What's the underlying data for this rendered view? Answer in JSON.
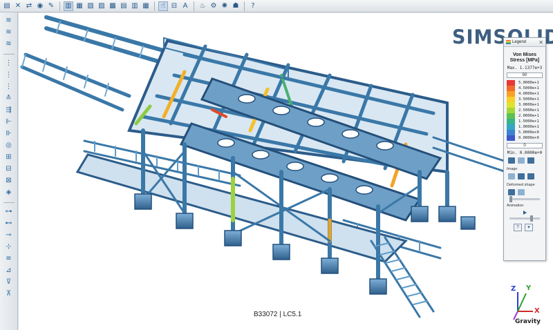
{
  "toolbar": {
    "buttons": [
      {
        "name": "open-icon",
        "glyph": "▤"
      },
      {
        "name": "cross-icon",
        "glyph": "✕"
      },
      {
        "name": "transform-icon",
        "glyph": "⇄"
      },
      {
        "name": "eye-icon",
        "glyph": "◉"
      },
      {
        "name": "pencil-icon",
        "glyph": "✎"
      },
      {
        "name": "sep"
      },
      {
        "name": "view-front-icon",
        "glyph": "▥",
        "active": true
      },
      {
        "name": "view-side-icon",
        "glyph": "▦"
      },
      {
        "name": "view-iso-icon",
        "glyph": "▧"
      },
      {
        "name": "view-top-icon",
        "glyph": "▨"
      },
      {
        "name": "view-bottom-icon",
        "glyph": "▩"
      },
      {
        "name": "view-left-icon",
        "glyph": "▤"
      },
      {
        "name": "view-right-icon",
        "glyph": "▥"
      },
      {
        "name": "view-back-icon",
        "glyph": "▦"
      },
      {
        "name": "sep"
      },
      {
        "name": "select-icon",
        "glyph": "☝",
        "active": true
      },
      {
        "name": "section-icon",
        "glyph": "⊟"
      },
      {
        "name": "measure-icon",
        "glyph": "A"
      },
      {
        "name": "sep"
      },
      {
        "name": "connections-icon",
        "glyph": "♨"
      },
      {
        "name": "bolt-icon",
        "glyph": "⚙"
      },
      {
        "name": "weld-icon",
        "glyph": "✺"
      },
      {
        "name": "material-icon",
        "glyph": "☗"
      },
      {
        "name": "sep"
      },
      {
        "name": "help-icon",
        "glyph": "?"
      }
    ]
  },
  "left_toolbar": {
    "groups": [
      [
        "≋",
        "≋",
        "≋"
      ],
      [
        "⋮",
        "⋮",
        "⋮",
        "≛",
        "⇶",
        "⊩",
        "⊪",
        "◎",
        "⊞",
        "⊟",
        "⊠",
        "◈"
      ],
      [
        "⊶",
        "⊷",
        "⊸",
        "⊹",
        "≡",
        "⊿",
        "⊽",
        "⊼"
      ]
    ]
  },
  "brand": {
    "text": "SIMSOLID",
    "color": "#3f5f80"
  },
  "caption": "B33072 | LC5.1",
  "legend": {
    "header": "Legend",
    "title_line1": "Von Mises",
    "title_line2": "Stress [MPa]",
    "max": "Max. 1.1377e+3",
    "upper_input": "50",
    "lower_input": "0",
    "min": "Min. 0.0000e+0",
    "scale": [
      {
        "label": "5.0000e+1",
        "color": "#e8363a"
      },
      {
        "label": "4.5000e+1",
        "color": "#f06a2a"
      },
      {
        "label": "4.0000e+1",
        "color": "#f7a126"
      },
      {
        "label": "3.5000e+1",
        "color": "#f6cf2c"
      },
      {
        "label": "3.0000e+1",
        "color": "#dfe32e"
      },
      {
        "label": "2.5000e+1",
        "color": "#a4d63a"
      },
      {
        "label": "2.0000e+1",
        "color": "#5cc24f"
      },
      {
        "label": "1.5000e+1",
        "color": "#38b488"
      },
      {
        "label": "1.0000e+1",
        "color": "#33a7c4"
      },
      {
        "label": "5.0000e+0",
        "color": "#3f82d0"
      },
      {
        "label": "0.0000e+0",
        "color": "#3c58c7"
      }
    ],
    "image_label": "Image",
    "deformed_label": "Deformed shape",
    "animation_label": "Animation"
  },
  "triad": {
    "z": "Z",
    "y": "Y",
    "x": "X",
    "gravity": "Gravity"
  }
}
